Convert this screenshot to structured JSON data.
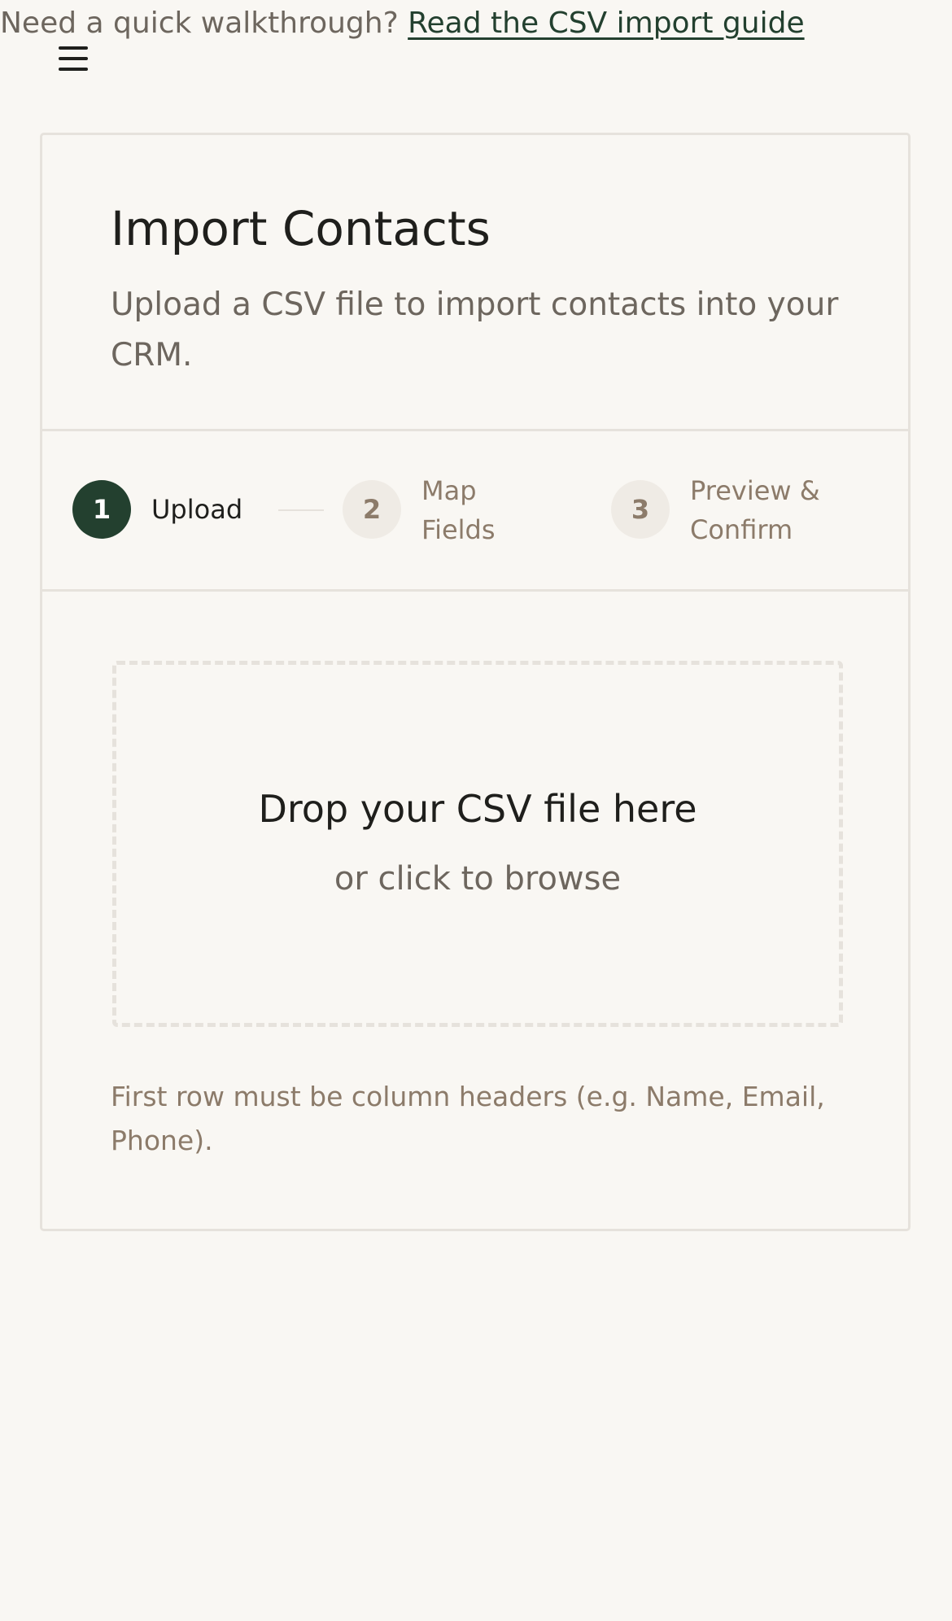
{
  "topbar": {
    "prompt": "Need a quick walkthrough? ",
    "guide_link": "Read the CSV import guide"
  },
  "menu": {
    "icon": "hamburger-menu-icon"
  },
  "card": {
    "title": "Import Contacts",
    "subtitle": "Upload a CSV file to import contacts into your CRM."
  },
  "steps": [
    {
      "number": "1",
      "label": "Upload",
      "state": "active"
    },
    {
      "number": "2",
      "label": "Map Fields",
      "state": "inactive"
    },
    {
      "number": "3",
      "label": "Preview & Confirm",
      "state": "inactive"
    }
  ],
  "dropzone": {
    "title": "Drop your CSV file here",
    "subtitle": "or click to browse"
  },
  "hint": "First row must be column headers (e.g. Name, Email, Phone).",
  "colors": {
    "accent": "#23402f",
    "background": "#f9f7f3",
    "border": "#e6e2dc",
    "muted_text": "#6d665e",
    "step_inactive_text": "#8c7b6a"
  }
}
